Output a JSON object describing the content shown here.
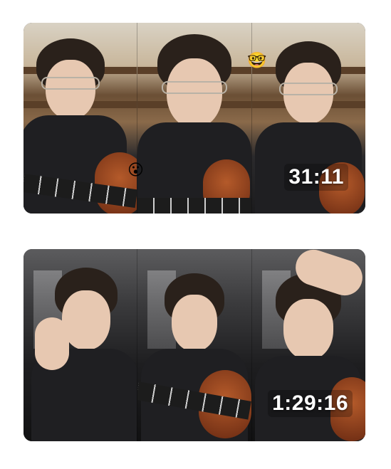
{
  "videos": [
    {
      "duration": "31:11",
      "emojis": [
        "😮",
        "🤓"
      ]
    },
    {
      "duration": "1:29:16"
    }
  ]
}
